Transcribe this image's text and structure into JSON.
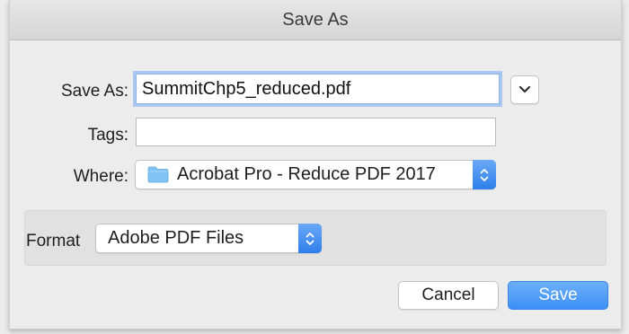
{
  "window": {
    "title": "Save As"
  },
  "save_as": {
    "label": "Save As:",
    "value": "SummitChp5_reduced.pdf"
  },
  "tags": {
    "label": "Tags:",
    "value": ""
  },
  "where": {
    "label": "Where:",
    "value": "Acrobat Pro - Reduce PDF 2017",
    "icon": "folder-icon"
  },
  "format": {
    "label": "Format",
    "value": "Adobe PDF Files"
  },
  "buttons": {
    "cancel": "Cancel",
    "save": "Save"
  },
  "colors": {
    "accent": "#3d8ff5",
    "folder": "#7ec3f2",
    "focus_ring": "#a9c8f0"
  }
}
